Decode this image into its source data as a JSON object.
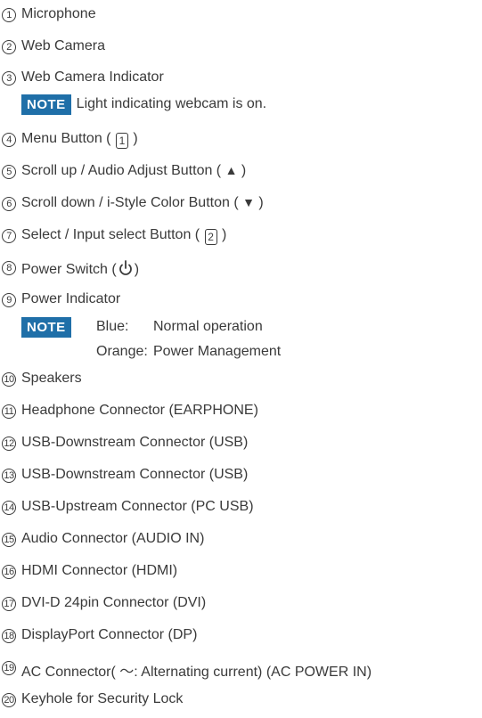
{
  "items": [
    {
      "n": "1",
      "text": "Microphone"
    },
    {
      "n": "2",
      "text": "Web Camera"
    },
    {
      "n": "3",
      "text": "Web Camera Indicator"
    },
    {
      "n": "4",
      "text": "Menu Button (",
      "key": "1",
      "after": ")"
    },
    {
      "n": "5",
      "text": "Scroll up / Audio Adjust Button (",
      "glyph": "▲",
      "after": ")"
    },
    {
      "n": "6",
      "text": "Scroll down / i-Style Color Button (",
      "glyph": "▼",
      "after": ")"
    },
    {
      "n": "7",
      "text": "Select / Input select Button (",
      "key": "2",
      "after": ")"
    },
    {
      "n": "8",
      "text": "Power Switch (",
      "after": ")"
    },
    {
      "n": "9",
      "text": "Power Indicator"
    },
    {
      "n": "10",
      "text": "Speakers"
    },
    {
      "n": "11",
      "text": "Headphone Connector (EARPHONE)"
    },
    {
      "n": "12",
      "text": "USB-Downstream Connector (USB)"
    },
    {
      "n": "13",
      "text": "USB-Downstream Connector (USB)"
    },
    {
      "n": "14",
      "text": "USB-Upstream Connector (PC USB)"
    },
    {
      "n": "15",
      "text": "Audio Connector (AUDIO IN)"
    },
    {
      "n": "16",
      "text": "HDMI Connector (HDMI)"
    },
    {
      "n": "17",
      "text": "DVI-D 24pin Connector (DVI)"
    },
    {
      "n": "18",
      "text": "DisplayPort Connector (DP)"
    },
    {
      "n": "19",
      "text": "AC Connector(",
      "glyph": "～",
      "mid": ": Alternating current) (AC POWER IN)"
    },
    {
      "n": "20",
      "text": "Keyhole for Security Lock"
    }
  ],
  "notes": {
    "badge": "NOTE",
    "webcam": "Light indicating webcam is on.",
    "power": [
      {
        "color": "Blue:",
        "meaning": "Normal operation"
      },
      {
        "color": "Orange:",
        "meaning": "Power Management"
      }
    ]
  },
  "colors": {
    "text": "#3a3a3a",
    "note_bg": "#1f6fa8",
    "note_fg": "#ffffff"
  }
}
